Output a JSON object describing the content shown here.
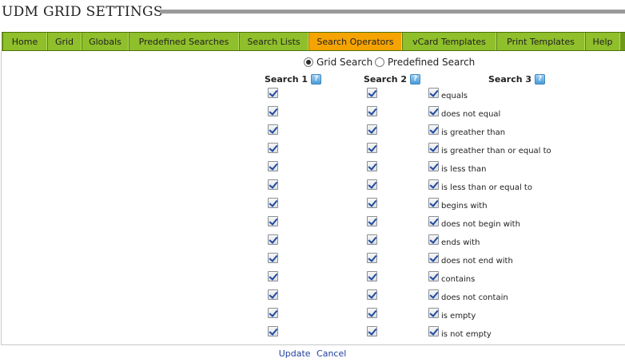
{
  "header": {
    "title": "UDM GRID SETTINGS"
  },
  "nav": {
    "tabs": [
      {
        "label": "Home",
        "active": false
      },
      {
        "label": "Grid",
        "active": false
      },
      {
        "label": "Globals",
        "active": false
      },
      {
        "label": "Predefined Searches",
        "active": false
      },
      {
        "label": "Search Lists",
        "active": false
      },
      {
        "label": "Search Operators",
        "active": true
      },
      {
        "label": "vCard Templates",
        "active": false
      },
      {
        "label": "Print Templates",
        "active": false
      },
      {
        "label": "Help",
        "active": false
      }
    ]
  },
  "mode": {
    "options": [
      {
        "label": "Grid Search",
        "selected": true
      },
      {
        "label": "Predefined Search",
        "selected": false
      }
    ]
  },
  "columns": [
    {
      "label": "Search 1",
      "help_icon": "help-icon"
    },
    {
      "label": "Search 2",
      "help_icon": "help-icon"
    },
    {
      "label": "Search 3",
      "help_icon": "help-icon"
    }
  ],
  "operators": [
    {
      "label": "equals",
      "search1": true,
      "search2": true,
      "search3": true
    },
    {
      "label": "does not equal",
      "search1": true,
      "search2": true,
      "search3": true
    },
    {
      "label": "is greather than",
      "search1": true,
      "search2": true,
      "search3": true
    },
    {
      "label": "is greather than or equal to",
      "search1": true,
      "search2": true,
      "search3": true
    },
    {
      "label": "is less than",
      "search1": true,
      "search2": true,
      "search3": true
    },
    {
      "label": "is less than or equal to",
      "search1": true,
      "search2": true,
      "search3": true
    },
    {
      "label": "begins with",
      "search1": true,
      "search2": true,
      "search3": true
    },
    {
      "label": "does not begin with",
      "search1": true,
      "search2": true,
      "search3": true
    },
    {
      "label": "ends with",
      "search1": true,
      "search2": true,
      "search3": true
    },
    {
      "label": "does not end with",
      "search1": true,
      "search2": true,
      "search3": true
    },
    {
      "label": "contains",
      "search1": true,
      "search2": true,
      "search3": true
    },
    {
      "label": "does not contain",
      "search1": true,
      "search2": true,
      "search3": true
    },
    {
      "label": "is empty",
      "search1": true,
      "search2": true,
      "search3": true
    },
    {
      "label": "is not empty",
      "search1": true,
      "search2": true,
      "search3": true
    }
  ],
  "footer": {
    "update_label": "Update",
    "cancel_label": "Cancel"
  },
  "colors": {
    "nav_bar": "#6f9b18",
    "tab": "#8fbf2a",
    "tab_active": "#f5a300",
    "link": "#1f3f9e"
  }
}
